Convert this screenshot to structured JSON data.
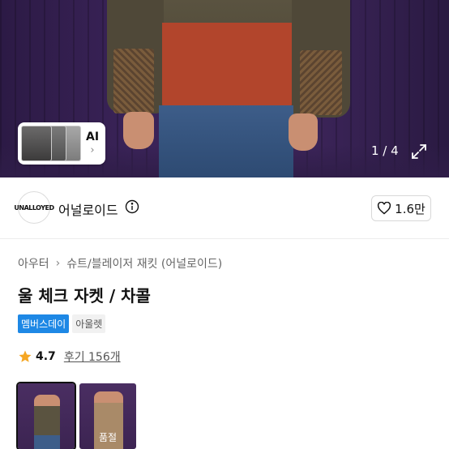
{
  "hero": {
    "ai_label": "AI",
    "pager": "1 / 4"
  },
  "brand": {
    "logo_text": "UNALLOYED",
    "name": "어널로이드",
    "like_count": "1.6만"
  },
  "breadcrumb": [
    "아우터",
    "슈트/블레이저 재킷 (어널로이드)"
  ],
  "product": {
    "title": "울 체크 자켓 / 차콜",
    "tags": [
      "멤버스데이",
      "아울렛"
    ],
    "rating": "4.7",
    "review_text": "후기 156개"
  },
  "color_options": [
    {
      "label": "",
      "selected": true
    },
    {
      "label": "품절",
      "selected": false
    }
  ],
  "colors": {
    "accent": "#1e88e5",
    "star": "#f5a623"
  }
}
